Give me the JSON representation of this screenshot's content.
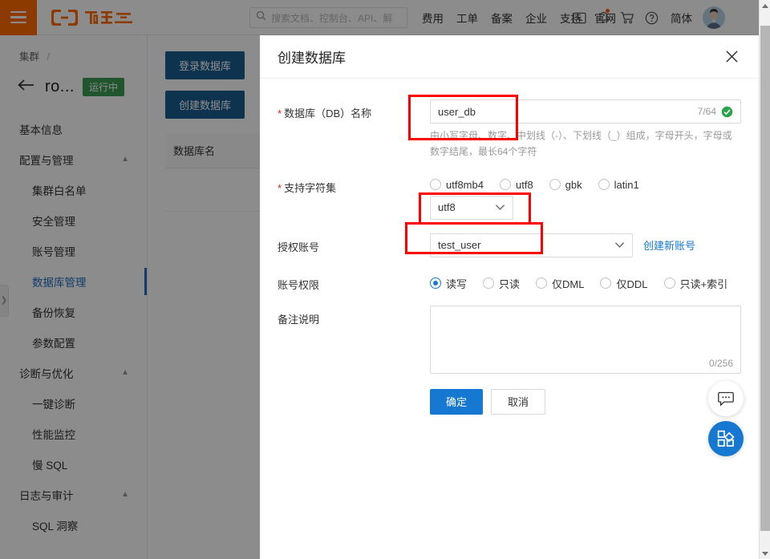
{
  "header": {
    "menu_icon": "hamburger-icon",
    "logo_text": "阿里云",
    "search": {
      "placeholder": "搜索文档、控制台、API、解",
      "icon": "search-icon"
    },
    "nav": [
      {
        "label": "费用"
      },
      {
        "label": "工单"
      },
      {
        "label": "备案"
      },
      {
        "label": "企业"
      },
      {
        "label": "支持"
      },
      {
        "label": "官网"
      }
    ],
    "icons": [
      {
        "name": "console-terminal-icon"
      },
      {
        "name": "bell-notification-icon",
        "has_dot": true
      },
      {
        "name": "shopping-cart-icon"
      },
      {
        "name": "help-circle-icon"
      }
    ],
    "language": "简体",
    "avatar": "user-avatar"
  },
  "sidebar": {
    "breadcrumb": "集群",
    "breadcrumb_sep": "/",
    "instance_name": "ro...",
    "status_badge": "运行中",
    "items": [
      {
        "label": "基本信息",
        "type": "top"
      },
      {
        "label": "配置与管理",
        "type": "group"
      },
      {
        "label": "集群白名单",
        "type": "sub"
      },
      {
        "label": "安全管理",
        "type": "sub"
      },
      {
        "label": "账号管理",
        "type": "sub"
      },
      {
        "label": "数据库管理",
        "type": "sub",
        "active": true
      },
      {
        "label": "备份恢复",
        "type": "sub"
      },
      {
        "label": "参数配置",
        "type": "sub"
      },
      {
        "label": "诊断与优化",
        "type": "group"
      },
      {
        "label": "一键诊断",
        "type": "sub"
      },
      {
        "label": "性能监控",
        "type": "sub"
      },
      {
        "label": "慢 SQL",
        "type": "sub"
      },
      {
        "label": "日志与审计",
        "type": "group"
      },
      {
        "label": "SQL 洞察",
        "type": "sub"
      }
    ]
  },
  "content": {
    "login_db_button": "登录数据库",
    "create_db_button": "创建数据库",
    "table_header_dbname": "数据库名"
  },
  "modal": {
    "title": "创建数据库",
    "close_icon": "close-icon",
    "db_name": {
      "label": "数据库（DB）名称",
      "required": true,
      "value": "user_db",
      "counter": "7/64",
      "valid_icon": "check-circle-icon",
      "hint": "由小写字母、数字、中划线（-）、下划线（_）组成，字母开头，字母或数字结尾，最长64个字符"
    },
    "charset": {
      "label": "支持字符集",
      "required": true,
      "options": [
        {
          "label": "utf8mb4",
          "checked": false
        },
        {
          "label": "utf8",
          "checked": false
        },
        {
          "label": "gbk",
          "checked": false
        },
        {
          "label": "latin1",
          "checked": false
        }
      ],
      "select_value": "utf8"
    },
    "account": {
      "label": "授权账号",
      "value": "test_user",
      "create_link": "创建新账号"
    },
    "privilege": {
      "label": "账号权限",
      "options": [
        {
          "label": "读写",
          "checked": true
        },
        {
          "label": "只读",
          "checked": false
        },
        {
          "label": "仅DML",
          "checked": false
        },
        {
          "label": "仅DDL",
          "checked": false
        },
        {
          "label": "只读+索引",
          "checked": false
        }
      ]
    },
    "remark": {
      "label": "备注说明",
      "value": "",
      "counter": "0/256"
    },
    "ok_button": "确定",
    "cancel_button": "取消"
  },
  "floating": {
    "chat_icon": "chat-bubble-icon",
    "apps_icon": "app-grid-icon"
  },
  "colors": {
    "brand_orange": "#ff6a00",
    "primary_blue": "#1678d1",
    "dark_blue": "#1b5e8f",
    "status_green": "#3c9c54",
    "annotation_red": "#ff0000"
  }
}
